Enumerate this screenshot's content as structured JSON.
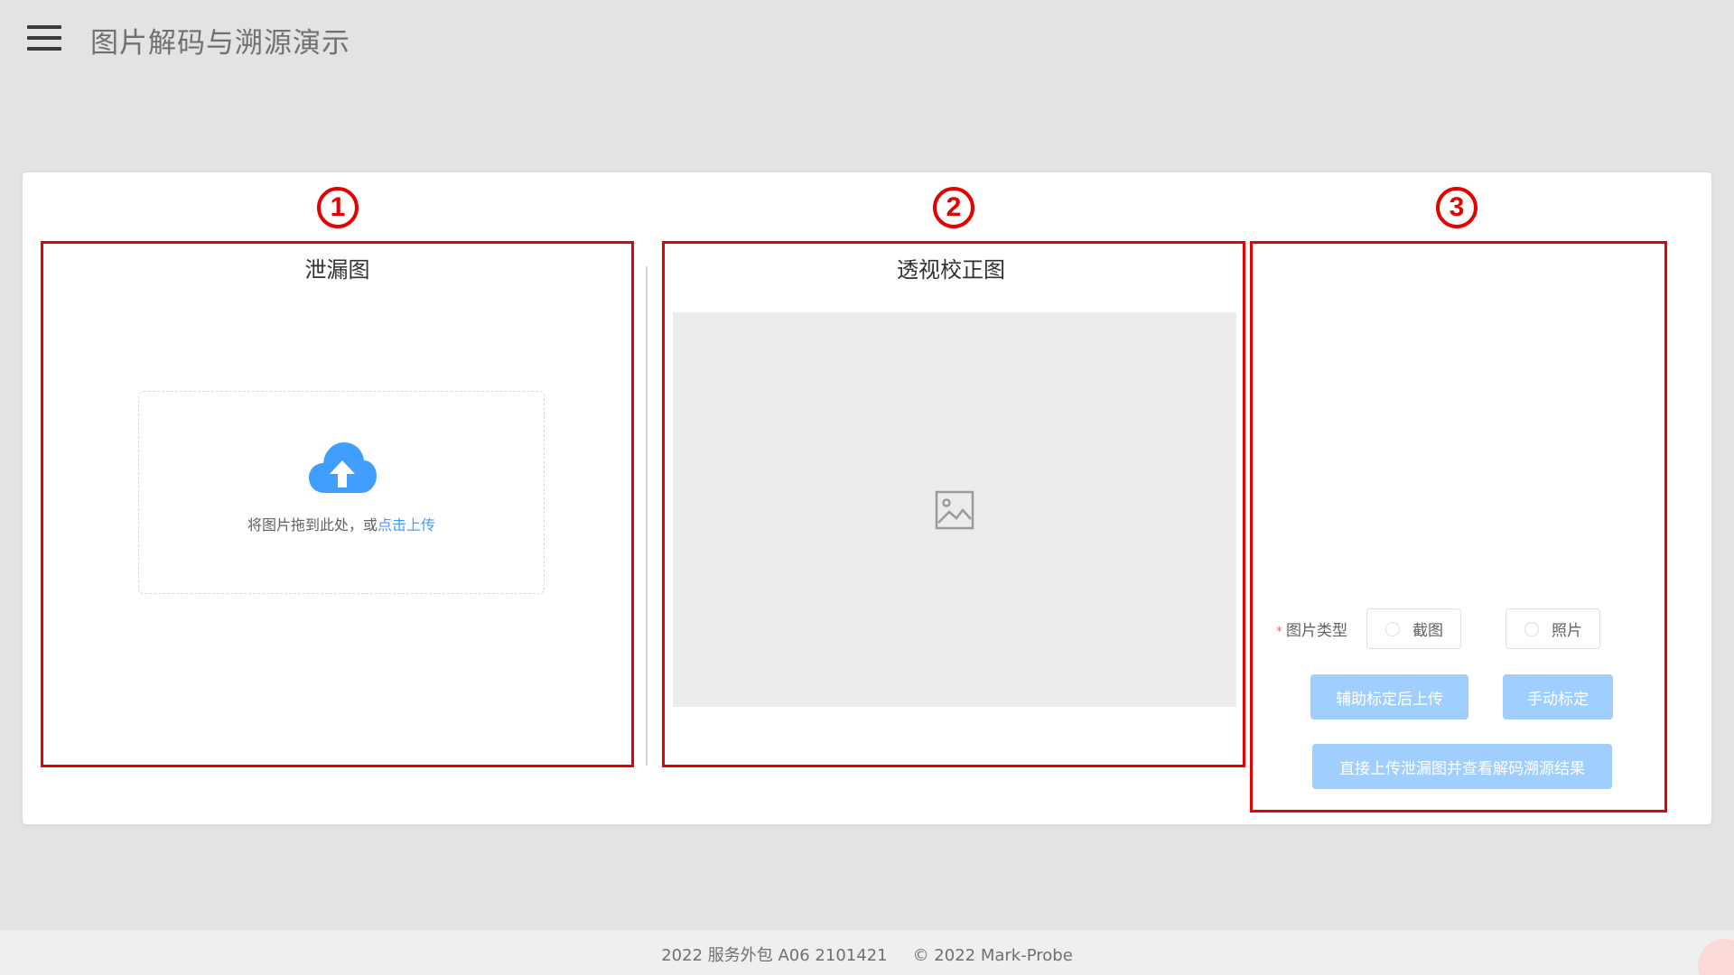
{
  "header": {
    "title": "图片解码与溯源演示",
    "menu_icon": "hamburger-menu-icon"
  },
  "markers": [
    "①",
    "②",
    "③"
  ],
  "panels": {
    "leak": {
      "title": "泄漏图",
      "upload": {
        "hint": "将图片拖到此处，或",
        "link": "点击上传",
        "icon": "cloud-upload-icon"
      }
    },
    "rectified": {
      "title": "透视校正图",
      "placeholder_icon": "image-placeholder-icon"
    },
    "actions": {
      "image_type_label": "图片类型",
      "required_mark": "*",
      "options": [
        "截图",
        "照片"
      ],
      "btn_assist": "辅助标定后上传",
      "btn_manual": "手动标定",
      "btn_direct": "直接上传泄漏图并查看解码溯源结果"
    }
  },
  "footer": {
    "left": "2022 服务外包 A06 2101421",
    "right": "© 2022 Mark-Probe"
  },
  "colors": {
    "accent": "#409eff",
    "annotation": "#e60000",
    "button_disabled": "#a0cfff"
  }
}
